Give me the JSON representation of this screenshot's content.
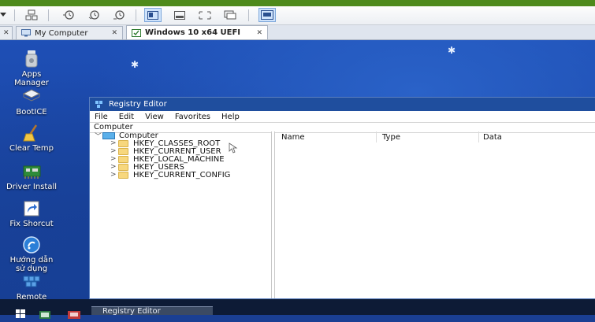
{
  "tabs": [
    {
      "label": "My Computer",
      "close": "✕"
    },
    {
      "label": "Windows 10 x64 UEFI",
      "close": "✕"
    }
  ],
  "tab_left_close": "✕",
  "desktop_icons": [
    {
      "label": "Apps\nManager",
      "icon": "apps-manager-icon"
    },
    {
      "label": "BootICE",
      "icon": "bootice-icon"
    },
    {
      "label": "Clear Temp",
      "icon": "broom-icon"
    },
    {
      "label": "Driver Install",
      "icon": "driver-icon"
    },
    {
      "label": "Fix Shorcut",
      "icon": "shortcut-icon"
    },
    {
      "label": "Hướng dẫn\nsử dụng",
      "icon": "help-icon"
    },
    {
      "label": "Remote\nRegistry",
      "icon": "remote-registry-icon"
    }
  ],
  "registry": {
    "title": "Registry Editor",
    "menu": [
      "File",
      "Edit",
      "View",
      "Favorites",
      "Help"
    ],
    "address": "Computer",
    "tree_root": "Computer",
    "keys": [
      "HKEY_CLASSES_ROOT",
      "HKEY_CURRENT_USER",
      "HKEY_LOCAL_MACHINE",
      "HKEY_USERS",
      "HKEY_CURRENT_CONFIG"
    ],
    "columns": [
      "Name",
      "Type",
      "Data"
    ]
  },
  "taskbar": {
    "active_task": "Registry Editor"
  },
  "colors": {
    "vm_accent": "#4e8a1c",
    "title_bar": "#1f4e9e",
    "taskbar": "#0d1b36"
  }
}
